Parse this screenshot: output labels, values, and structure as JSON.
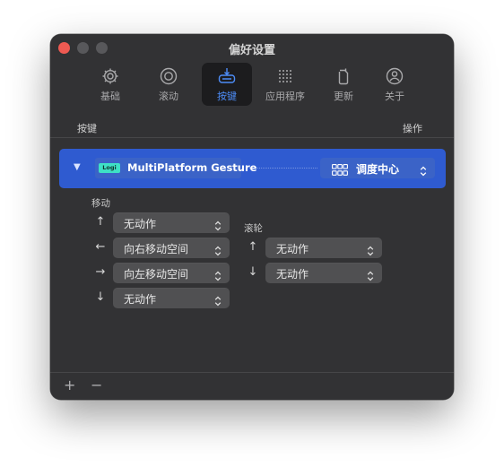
{
  "window": {
    "title": "偏好设置"
  },
  "toolbar": {
    "items": [
      {
        "label": "基础",
        "icon": "gear-icon",
        "active": false
      },
      {
        "label": "滚动",
        "icon": "scroll-icon",
        "active": false
      },
      {
        "label": "按键",
        "icon": "keyboard-mouse-icon",
        "active": true
      },
      {
        "label": "应用程序",
        "icon": "app-grid-icon",
        "active": false
      },
      {
        "label": "更新",
        "icon": "update-icon",
        "active": false
      },
      {
        "label": "关于",
        "icon": "about-icon",
        "active": false
      }
    ]
  },
  "table_header": {
    "left": "按键",
    "right": "操作"
  },
  "device": {
    "badge": "Logi",
    "name": "MultiPlatform Gesture",
    "action_icon": "mission-control-grid-icon",
    "action_label": "调度中心"
  },
  "move_section": {
    "label": "移动",
    "rows": [
      {
        "arrow": "↑",
        "value": "无动作"
      },
      {
        "arrow": "←",
        "value": "向右移动空间"
      },
      {
        "arrow": "→",
        "value": "向左移动空间"
      },
      {
        "arrow": "↓",
        "value": "无动作"
      }
    ]
  },
  "scroll_section": {
    "label": "滚轮",
    "rows": [
      {
        "arrow": "↑",
        "value": "无动作"
      },
      {
        "arrow": "↓",
        "value": "无动作"
      }
    ]
  },
  "footer": {
    "add": "+",
    "remove": "−"
  },
  "colors": {
    "window_bg": "#323234",
    "accent_blue": "#2f5bd0",
    "active_tab_label": "#4d8cf6",
    "logi_badge": "#3ee0c5",
    "close_button": "#ee5a52"
  }
}
